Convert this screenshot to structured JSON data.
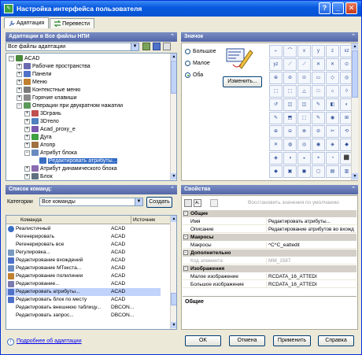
{
  "window": {
    "title": "Настройка интерфейса пользователя",
    "app_icon": "app-customize-icon"
  },
  "tabs": [
    {
      "label": "Адаптация",
      "active": true
    },
    {
      "label": "Перевести",
      "active": false
    }
  ],
  "customizations_panel": {
    "header": "Адаптации в Все файлы НПИ",
    "filter_value": "Все файлы адаптации",
    "tree": [
      {
        "label": "ACAD",
        "level": 0,
        "expander": "−"
      },
      {
        "label": "Рабочие пространства",
        "level": 1,
        "expander": "+"
      },
      {
        "label": "Панели",
        "level": 1,
        "expander": "+"
      },
      {
        "label": "Меню",
        "level": 1,
        "expander": "+"
      },
      {
        "label": "Контекстные меню",
        "level": 1,
        "expander": "+"
      },
      {
        "label": "Горячие клавиши",
        "level": 1,
        "expander": "+"
      },
      {
        "label": "Операции при двукратном нажатии",
        "level": 1,
        "expander": "−"
      },
      {
        "label": "3Dгрань",
        "level": 2,
        "expander": "+"
      },
      {
        "label": "3Dтело",
        "level": 2,
        "expander": "+"
      },
      {
        "label": "Acad_proxy_e",
        "level": 2,
        "expander": "+"
      },
      {
        "label": "Дуга",
        "level": 2,
        "expander": "+"
      },
      {
        "label": "Атопр",
        "level": 2,
        "expander": "+"
      },
      {
        "label": "Атрибут блока",
        "level": 2,
        "expander": "−"
      },
      {
        "label": "Редактировать атрибуты...",
        "level": 3,
        "expander": "",
        "selected": true
      },
      {
        "label": "Атрибут динамического блока",
        "level": 2,
        "expander": "+"
      },
      {
        "label": "Блок",
        "level": 2,
        "expander": "+"
      }
    ]
  },
  "image_panel": {
    "header": "Значок",
    "options": [
      {
        "label": "Большое",
        "checked": false
      },
      {
        "label": "Малое",
        "checked": false
      },
      {
        "label": "Оба",
        "checked": true
      }
    ],
    "edit_button": "Изменить...",
    "icon_labels": [
      "x",
      "y",
      "z",
      "xz",
      "yz"
    ]
  },
  "commands_panel": {
    "header": "Список команд:",
    "category_label": "Категории",
    "category_value": "Все команды",
    "create_button": "Создать",
    "columns": {
      "name": "Команда",
      "source": "Источник"
    },
    "rows": [
      {
        "name": "Реалистичный",
        "source": "ACAD"
      },
      {
        "name": "Регенерировать",
        "source": "ACAD"
      },
      {
        "name": "Регенерировать все",
        "source": "ACAD"
      },
      {
        "name": "Регулировка...",
        "source": "ACAD"
      },
      {
        "name": "Редактирование вхождений",
        "source": "ACAD"
      },
      {
        "name": "Редактирование МТекста...",
        "source": "ACAD"
      },
      {
        "name": "Редактирование полилинии",
        "source": "ACAD"
      },
      {
        "name": "Редактирование...",
        "source": "ACAD"
      },
      {
        "name": "Редактировать атрибуты...",
        "source": "ACAD",
        "selected": true
      },
      {
        "name": "Редактировать блок по месту",
        "source": "ACAD"
      },
      {
        "name": "Редактировать внешнюю таблицу...",
        "source": "DBCON..."
      },
      {
        "name": "Редактировать запрос...",
        "source": "DBCON..."
      }
    ]
  },
  "properties_panel": {
    "header": "Свойства",
    "reset_label": "Восстановить значения по умолчанию",
    "groups": [
      {
        "title": "Общие",
        "rows": [
          {
            "key": "Имя",
            "value": "Редактировать атрибуты...",
            "disabled": false
          },
          {
            "key": "Описание",
            "value": "Редактирование атрибутов во вхожд",
            "disabled": false
          }
        ]
      },
      {
        "title": "Макросы",
        "rows": [
          {
            "key": "Макросы",
            "value": "^C^C_eattedit",
            "disabled": false
          }
        ]
      },
      {
        "title": "Дополнительно",
        "rows": [
          {
            "key": "Код элемента",
            "value": "MM_1587",
            "disabled": true
          }
        ]
      },
      {
        "title": "Изображения",
        "rows": [
          {
            "key": "Малое изображение",
            "value": "RCDATA_16_ATTEDI",
            "disabled": false
          },
          {
            "key": "Большое изображение",
            "value": "RCDATA_16_ATTEDI",
            "disabled": false
          }
        ]
      }
    ],
    "description_title": "Общие"
  },
  "footer": {
    "link": "Подробнее об адаптации",
    "ok": "OK",
    "cancel": "Отмена",
    "apply": "Применить",
    "help": "Справка"
  }
}
